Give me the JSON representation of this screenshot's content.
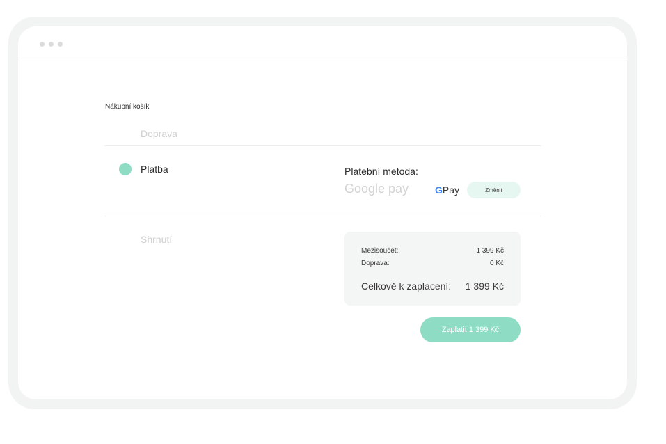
{
  "breadcrumb": "Nákupní košík",
  "steps": [
    {
      "label": "Doprava",
      "state": "inactive"
    },
    {
      "label": "Platba",
      "state": "active"
    },
    {
      "label": "Shrnutí",
      "state": "inactive"
    }
  ],
  "payment": {
    "method_label": "Platební metoda:",
    "method_value": "Google pay",
    "gpay_g": "G",
    "gpay_text": "Pay",
    "change_label": "Změnit"
  },
  "summary": {
    "subtotal_label": "Mezisoučet:",
    "subtotal_value": "1 399 Kč",
    "shipping_label": "Doprava:",
    "shipping_value": "0 Kč",
    "total_label": "Celkově k zaplacení:",
    "total_value": "1 399 Kč"
  },
  "pay_button_label": "Zaplatit 1 399 Kč",
  "colors": {
    "accent": "#8edcc3",
    "accent_light": "#e6f7f1",
    "frame": "#f2f3f3",
    "muted_text": "#cfcfcf"
  }
}
